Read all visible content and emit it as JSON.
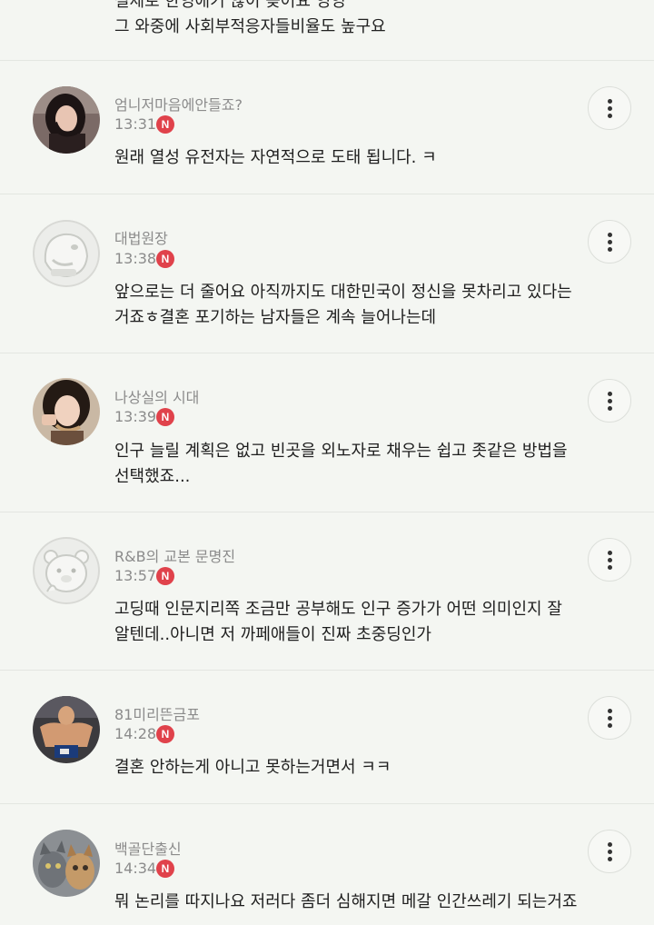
{
  "top_fragment": {
    "line_a": "실제로 한영애기 않이 늦어요 영영",
    "line_b": "그 와중에 사회부적응자들비율도 높구요"
  },
  "badge_letter": "N",
  "comments": [
    {
      "nickname": "엄니저마음에안들죠?",
      "time": "13:31",
      "lines": [
        "원래 열성 유전자는 자연적으로 도태 됩니다. ㅋ"
      ],
      "avatar": "photo-woman-icon"
    },
    {
      "nickname": "대법원장",
      "time": "13:38",
      "lines": [
        "앞으로는 더 줄어요 아직까지도 대한민국이 정신을 못차리고 있다는",
        "거죠ㅎ결혼 포기하는 남자들은 계속 늘어나는데"
      ],
      "avatar": "default-character-icon"
    },
    {
      "nickname": "나상실의 시대",
      "time": "13:39",
      "lines": [
        "인구 늘릴 계획은 없고 빈곳을 외노자로 채우는 쉽고 좃같은 방법을",
        "선택했죠..."
      ],
      "avatar": "photo-eating-woman-icon"
    },
    {
      "nickname": "R&B의 교본 문명진",
      "time": "13:57",
      "lines": [
        "고딩때 인문지리쪽 조금만 공부해도 인구 증가가 어떤 의미인지 잘",
        "알텐데..아니면 저 까페애들이 진짜 초중딩인가"
      ],
      "avatar": "bear-character-icon"
    },
    {
      "nickname": "81미리뜬금포",
      "time": "14:28",
      "lines": [
        "결혼 안하는게 아니고 못하는거면서 ㅋㅋ"
      ],
      "avatar": "photo-fighter-icon"
    },
    {
      "nickname": "백골단출신",
      "time": "14:34",
      "lines": [
        "뭐 논리를 따지나요 저러다 좀더 심해지면 메갈 인간쓰레기 되는거죠"
      ],
      "avatar": "photo-cats-icon"
    }
  ]
}
